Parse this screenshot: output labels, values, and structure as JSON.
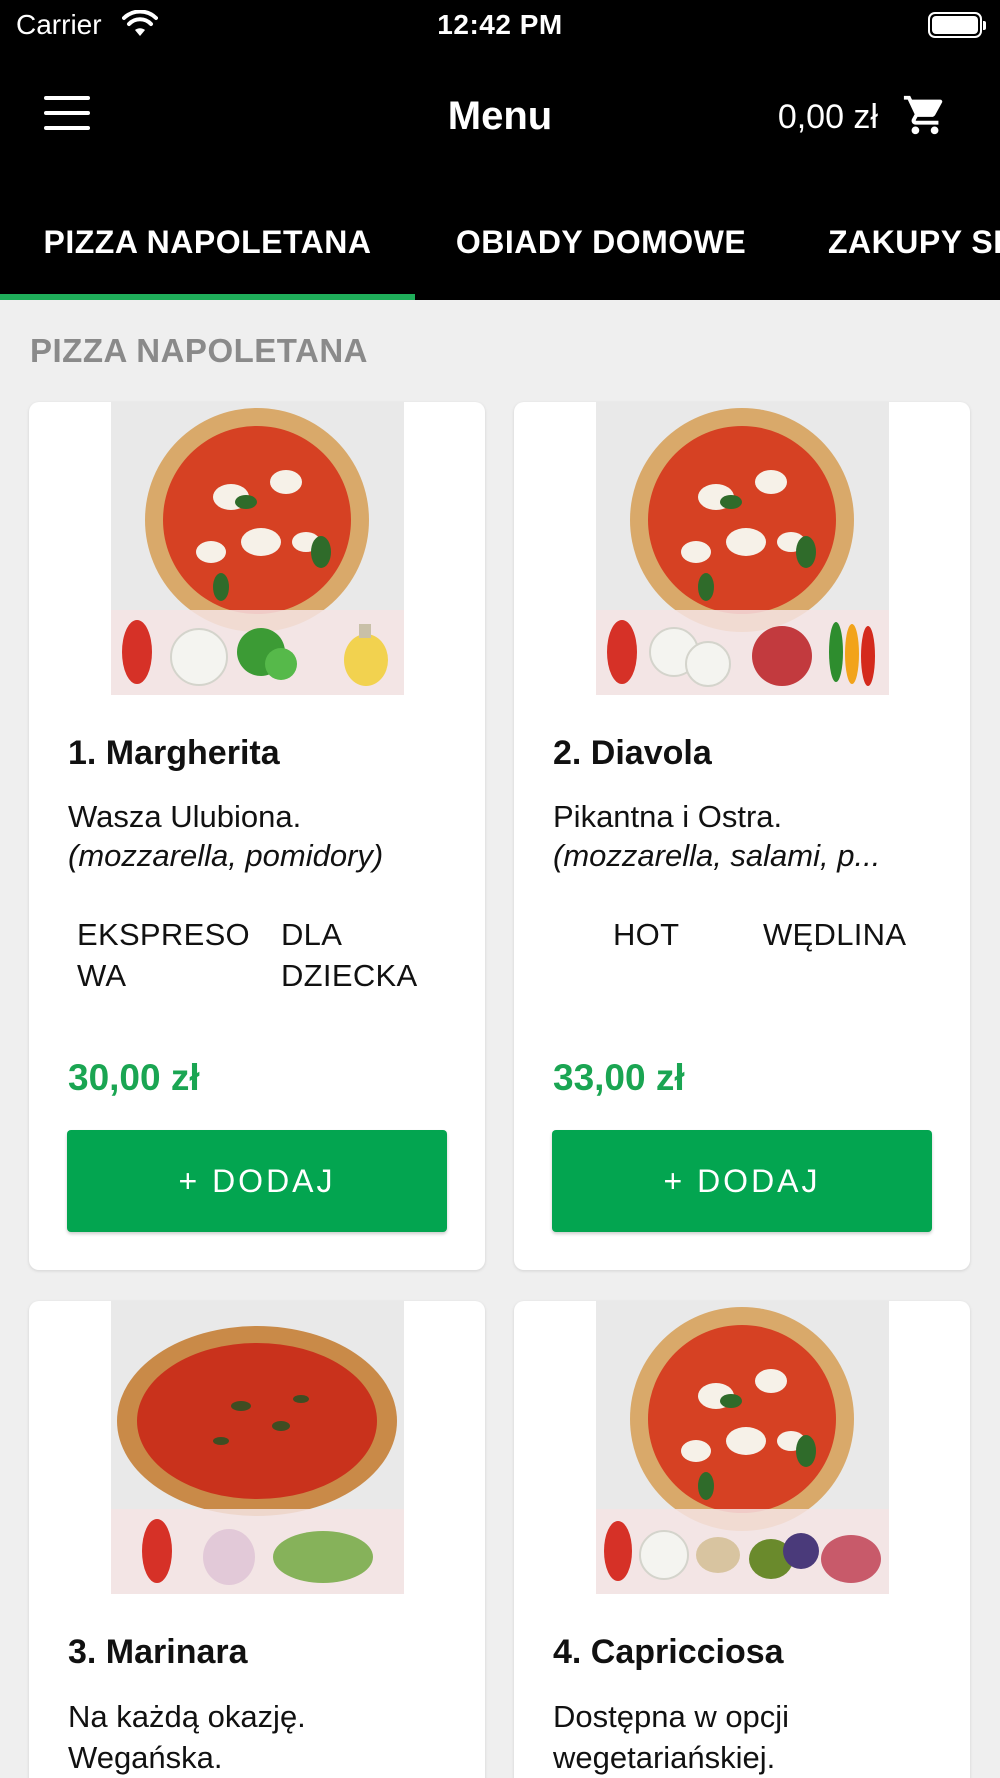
{
  "status_bar": {
    "carrier": "Carrier",
    "time": "12:42 PM"
  },
  "nav": {
    "title": "Menu",
    "cart_total": "0,00 zł"
  },
  "tabs": [
    {
      "label": "PIZZA NAPOLETANA",
      "active": true
    },
    {
      "label": "OBIADY DOMOWE",
      "active": false
    },
    {
      "label": "ZAKUPY SI",
      "active": false
    }
  ],
  "section": {
    "title": "PIZZA NAPOLETANA"
  },
  "colors": {
    "accent": "#1fae5a",
    "button": "#03a550",
    "price": "#1aa552"
  },
  "items": [
    {
      "name": "1. Margherita",
      "description": "Wasza Ulubiona.",
      "ingredients": "(mozzarella, pomidory)",
      "tags": [
        {
          "line1": "EKSPRESO",
          "line2": "WA"
        },
        {
          "line1": "DLA",
          "line2": "DZIECKA"
        }
      ],
      "price": "30,00 zł",
      "button": "+ DODAJ"
    },
    {
      "name": "2. Diavola",
      "description": "Pikantna i Ostra.",
      "ingredients": "(mozzarella, salami, p...",
      "tags": [
        {
          "line1": "HOT"
        },
        {
          "line1": "WĘDLINA"
        }
      ],
      "price": "33,00 zł",
      "button": "+ DODAJ"
    },
    {
      "name": "3. Marinara",
      "description_line1": "Na każdą okazję.",
      "description_line2": "Wegańska."
    },
    {
      "name": "4. Capricciosa",
      "description_line1": "Dostępna w opcji",
      "description_line2": "wegetariańskiej."
    }
  ]
}
